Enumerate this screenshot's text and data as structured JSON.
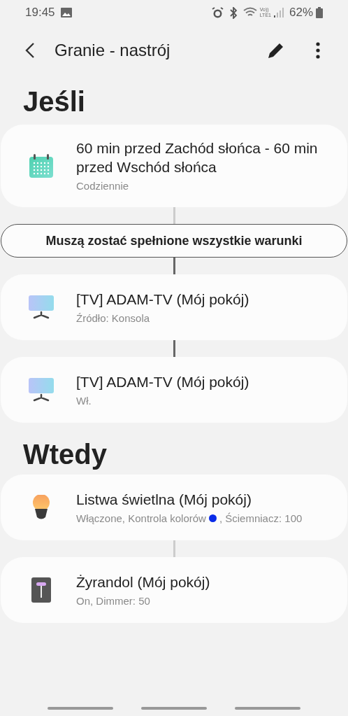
{
  "status_bar": {
    "time": "19:45",
    "network": "Vo))\nLTE1",
    "battery": "62%"
  },
  "app_bar": {
    "title": "Granie - nastrój"
  },
  "if_section": {
    "heading": "Jeśli",
    "conditions": [
      {
        "kind": "calendar",
        "title": "60 min przed Zachód słońca - 60 min przed Wschód słońca",
        "detail": "Codziennie"
      },
      {
        "kind": "tv",
        "title": "[TV] ADAM-TV (Mój pokój)",
        "detail": "Źródło: Konsola"
      },
      {
        "kind": "tv",
        "title": "[TV] ADAM-TV (Mój pokój)",
        "detail": "Wł."
      }
    ],
    "rule_button": "Muszą zostać spełnione wszystkie warunki"
  },
  "then_section": {
    "heading": "Wtedy",
    "actions": [
      {
        "kind": "bulb",
        "title": "Listwa świetlna (Mój pokój)",
        "detail": "Włączone, Kontrola kolorów",
        "color": "#0a2be8",
        "detail_after": ", Ściemniacz: 100"
      },
      {
        "kind": "lamp",
        "title": "Żyrandol (Mój pokój)",
        "detail": "On, Dimmer: 50"
      }
    ]
  }
}
